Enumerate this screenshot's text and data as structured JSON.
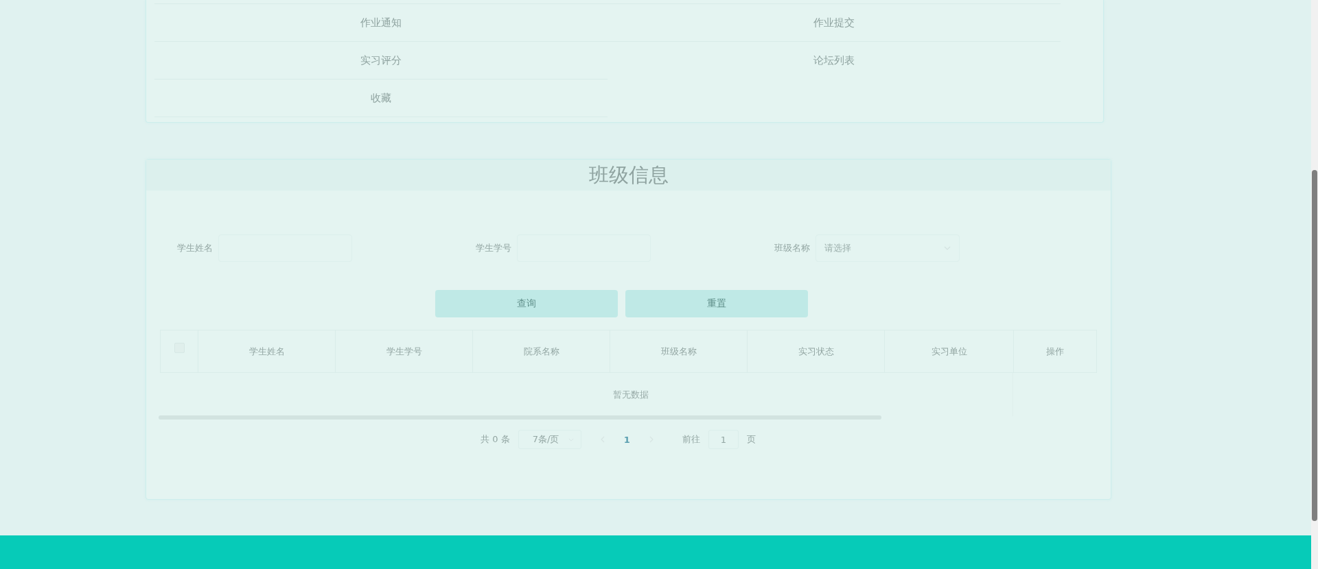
{
  "menu": {
    "items": [
      {
        "label": "作业通知"
      },
      {
        "label": "作业提交"
      },
      {
        "label": "实习评分"
      },
      {
        "label": "论坛列表"
      },
      {
        "label": "收藏"
      }
    ]
  },
  "class_panel": {
    "title": "班级信息",
    "filters": [
      {
        "kind": "input",
        "label": "学生姓名"
      },
      {
        "kind": "input",
        "label": "学生学号"
      },
      {
        "kind": "select",
        "label": "班级名称",
        "placeholder": "请选择"
      }
    ],
    "buttons": [
      "查询",
      "重置"
    ],
    "table": {
      "select_all": {
        "checked": false
      },
      "columns": [
        "学生姓名",
        "学生学号",
        "院系名称",
        "班级名称",
        "实习状态",
        "实习单位",
        "操作"
      ],
      "empty_text": "暂无数据"
    },
    "pagination": {
      "total": "共 0 条",
      "page_size": "7条/页",
      "pages": [
        {
          "label": "1",
          "selected": true
        }
      ],
      "goto_label": "前往",
      "goto_value": "1",
      "goto_suffix": "页"
    }
  }
}
